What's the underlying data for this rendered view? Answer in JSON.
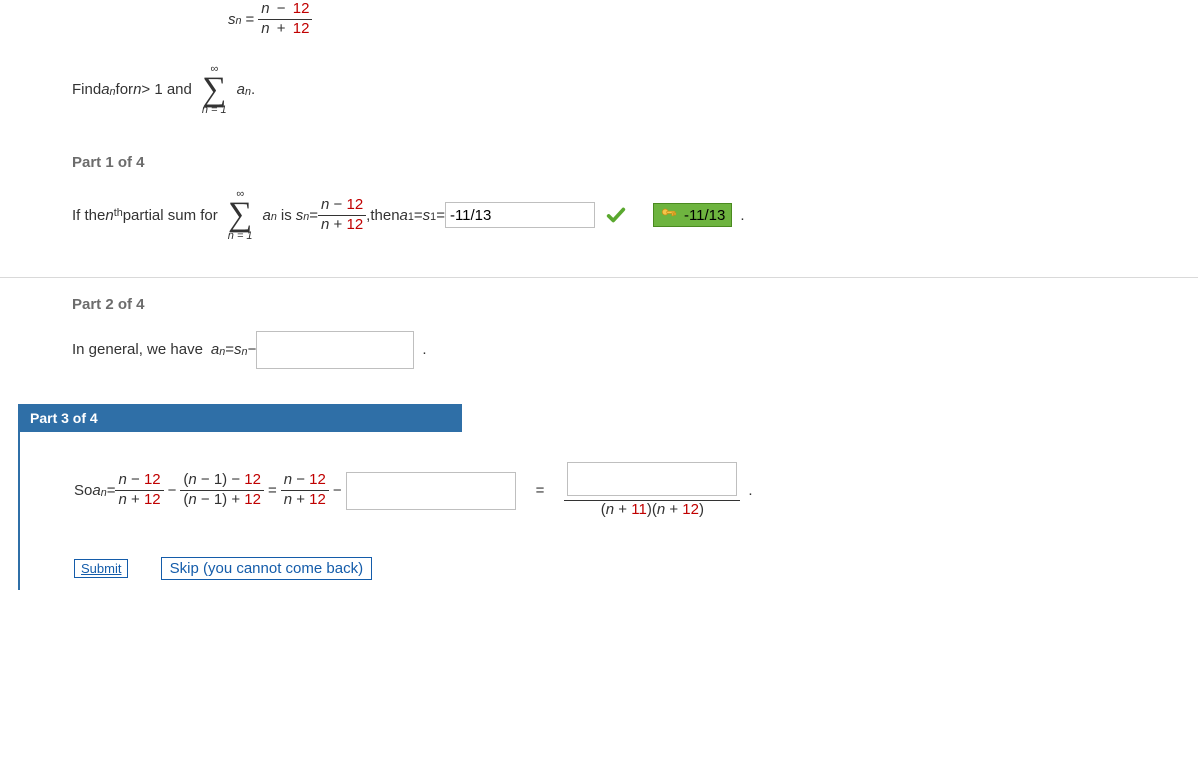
{
  "header": {
    "sn_lhs": "s",
    "sn_sub": "n",
    "eq": "=",
    "frac_num_a": "n",
    "frac_num_op": "−",
    "frac_num_b": "12",
    "frac_den_a": "n",
    "frac_den_op": "+",
    "frac_den_b": "12",
    "find_pre": "Find ",
    "a": "a",
    "a_sub": "n",
    "find_mid": " for ",
    "n": "n",
    "gt": " > 1 and ",
    "sigma_top": "∞",
    "sigma_bot": "n = 1",
    "sigma_a": "a",
    "sigma_a_sub": "n",
    "period": "."
  },
  "part1": {
    "heading": "Part 1 of 4",
    "text_pre": "If the ",
    "nth_n": "n",
    "nth_th": "th",
    "text_mid": " partial sum for ",
    "sigma_top": "∞",
    "sigma_bot": "n = 1",
    "sigma_a": "a",
    "sigma_a_sub": "n",
    "is": " is ",
    "sn_s": "s",
    "sn_sub": "n",
    "eq": " = ",
    "frac_num_a": "n",
    "frac_num_op": " − ",
    "frac_num_b": "12",
    "frac_den_a": "n",
    "frac_den_op": " + ",
    "frac_den_b": "12",
    "comma": ", ",
    "then": " then ",
    "a1_a": "a",
    "a1_sub": "1",
    "eq2": " = ",
    "s1_s": "s",
    "s1_sub": "1",
    "eq3": " = ",
    "input_value": "-11/13",
    "answer_value": "-11/13",
    "period": "."
  },
  "part2": {
    "heading": "Part 2 of 4",
    "text_pre": "In general, we have ",
    "a": "a",
    "a_sub": "n",
    "eq": " = ",
    "s": "s",
    "s_sub": "n",
    "minus": " − ",
    "input_value": "",
    "period": "."
  },
  "part3": {
    "heading": "Part 3 of 4",
    "so": "So ",
    "a": "a",
    "a_sub": "n",
    "eq": " = ",
    "f1_num_a": "n",
    "f1_num_op": " − ",
    "f1_num_b": "12",
    "f1_den_a": "n",
    "f1_den_op": " + ",
    "f1_den_b": "12",
    "minus1": " − ",
    "f2_num_a": "(",
    "f2_num_b": "n",
    "f2_num_c": " − 1) − ",
    "f2_num_d": "12",
    "f2_den_a": "(",
    "f2_den_b": "n",
    "f2_den_c": " − 1) + ",
    "f2_den_d": "12",
    "eq2": " = ",
    "f3_num_a": "n",
    "f3_num_op": " − ",
    "f3_num_b": "12",
    "f3_den_a": "n",
    "f3_den_op": " + ",
    "f3_den_b": "12",
    "minus2": " − ",
    "input1_value": "",
    "eq3": " = ",
    "input2_value": "",
    "final_den_a": "(",
    "final_den_b": "n",
    "final_den_c": " + ",
    "final_den_d": "11",
    "final_den_e": ")(",
    "final_den_f": "n",
    "final_den_g": " + ",
    "final_den_h": "12",
    "final_den_i": ")",
    "period": ".",
    "submit_label": "Submit",
    "skip_label": "Skip (you cannot come back)"
  }
}
